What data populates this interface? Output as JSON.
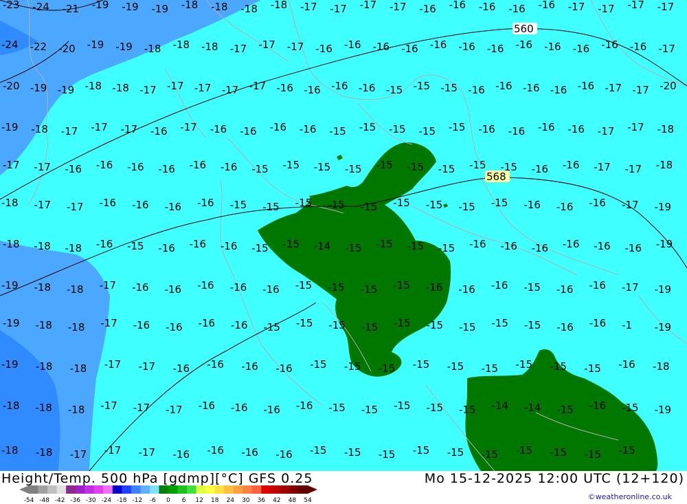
{
  "footer": {
    "title_left": "Height/Temp. 500 hPa [gdmp][°C] GFS 0.25",
    "title_right": "Mo 15-12-2025 12:00 UTC (12+120)",
    "credit": "©weatheronline.co.uk"
  },
  "legend": {
    "ticks": [
      "-54",
      "-48",
      "-42",
      "-36",
      "-30",
      "-24",
      "-18",
      "-12",
      "-6",
      "0",
      "6",
      "12",
      "18",
      "24",
      "30",
      "36",
      "42",
      "48",
      "54"
    ],
    "colors": [
      "#808080",
      "#a0a0a0",
      "#c0c0c0",
      "#e0e0e0",
      "#8b2b8b",
      "#a020c8",
      "#c030e0",
      "#e040f0",
      "#f070f8",
      "#0000c8",
      "#2040ff",
      "#4080ff",
      "#60b0ff",
      "#80e0ff",
      "#008000",
      "#00a000",
      "#20c020",
      "#40e040",
      "#e0ff40",
      "#ffff40",
      "#ffe040",
      "#ffc040",
      "#ffa040",
      "#ff8040",
      "#ff6040",
      "#e00000",
      "#c00000",
      "#a00000",
      "#800000",
      "#600000"
    ]
  },
  "map": {
    "colors": {
      "band_cold": "#2f8bff",
      "band_mid": "#4ca8ff",
      "main": "#3fffff",
      "warm": "#007800",
      "coast": "#b0b0b0",
      "contour": "#000000"
    },
    "contour_labels": [
      "560",
      "568"
    ],
    "temperature_labels": [
      "-23",
      "-24",
      "-21",
      "-19",
      "-19",
      "-19",
      "-18",
      "-18",
      "-18",
      "-18",
      "-17",
      "-17",
      "-17",
      "-17",
      "-16",
      "-16",
      "-16",
      "-16",
      "-16",
      "-17",
      "-17",
      "-17",
      "-17",
      "-24",
      "-22",
      "-20",
      "-19",
      "-19",
      "-18",
      "-18",
      "-18",
      "-17",
      "-17",
      "-17",
      "-16",
      "-16",
      "-16",
      "-16",
      "-16",
      "-16",
      "-16",
      "-16",
      "-16",
      "-16",
      "-16",
      "-16",
      "-17",
      "-20",
      "-19",
      "-19",
      "-18",
      "-18",
      "-17",
      "-17",
      "-17",
      "-17",
      "-17",
      "-16",
      "-16",
      "-16",
      "-16",
      "-15",
      "-15",
      "-15",
      "-16",
      "-16",
      "-16",
      "-16",
      "-16",
      "-17",
      "-17",
      "-20",
      "-19",
      "-18",
      "-17",
      "-17",
      "-17",
      "-16",
      "-17",
      "-16",
      "-16",
      "-16",
      "-16",
      "-15",
      "-15",
      "-15",
      "-15",
      "-15",
      "-16",
      "-16",
      "-16",
      "-16",
      "-17",
      "-17",
      "-18",
      "-17",
      "-17",
      "-16",
      "-16",
      "-16",
      "-16",
      "-16",
      "-16",
      "-15",
      "-15",
      "-15",
      "-15",
      "-15",
      "-15",
      "-15",
      "-15",
      "-15",
      "-16",
      "-16",
      "-17",
      "-17",
      "-18",
      "-18",
      "-17",
      "-17",
      "-16",
      "-16",
      "-16",
      "-16",
      "-15",
      "-15",
      "-15",
      "-15",
      "-15",
      "-15",
      "-15",
      "-15",
      "-15",
      "-16",
      "-16",
      "-16",
      "-17",
      "-19",
      "-18",
      "-18",
      "-18",
      "-16",
      "-15",
      "-16",
      "-16",
      "-16",
      "-15",
      "-15",
      "-14",
      "-15",
      "-15",
      "-15",
      "-15",
      "-16",
      "-16",
      "-16",
      "-16",
      "-16",
      "-16",
      "-19",
      "-19",
      "-18",
      "-18",
      "-17",
      "-16",
      "-16",
      "-16",
      "-16",
      "-16",
      "-15",
      "-15",
      "-15",
      "-15",
      "-16",
      "-16",
      "-16",
      "-15",
      "-16",
      "-16",
      "-17",
      "-19",
      "-19",
      "-18",
      "-18",
      "-17",
      "-16",
      "-16",
      "-16",
      "-16",
      "-15",
      "-15",
      "-15",
      "-15",
      "-15",
      "-15",
      "-15",
      "-15",
      "-15",
      "-16",
      "-16",
      "-1",
      "-19",
      "-19",
      "-18",
      "-18",
      "-17",
      "-17",
      "-16",
      "-16",
      "-16",
      "-16",
      "-15",
      "-15",
      "-15",
      "-15",
      "-15",
      "-15",
      "-15",
      "-15",
      "-15",
      "-16",
      "-18",
      "-18",
      "-18",
      "-18",
      "-17",
      "-17",
      "-17",
      "-16",
      "-16",
      "-16",
      "-16",
      "-15",
      "-15",
      "-15",
      "-15",
      "-15",
      "-14",
      "-14",
      "-15",
      "-16",
      "-15",
      "-19",
      "-18",
      "-18",
      "-17",
      "-17",
      "-17",
      "-16",
      "-16",
      "-16",
      "-16",
      "-15",
      "-15",
      "-15",
      "-15",
      "-15",
      "-15",
      "-15",
      "-15",
      "-15",
      "-15"
    ]
  }
}
